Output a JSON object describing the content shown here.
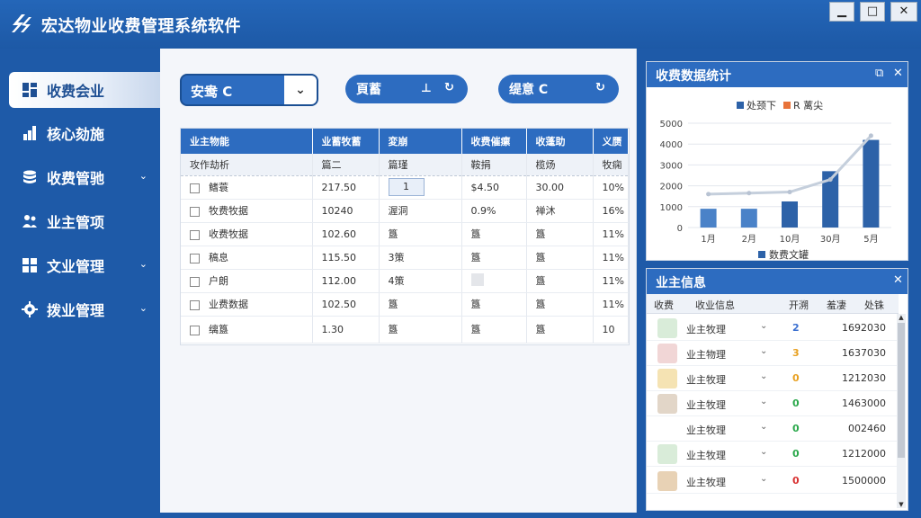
{
  "app": {
    "title": "宏达物业收费管理系统软件",
    "window_buttons": [
      "▁",
      "□",
      "✕"
    ]
  },
  "sidebar": {
    "items": [
      {
        "label": "收费会业",
        "icon": "grid-icon",
        "active": true,
        "has_chevron": false
      },
      {
        "label": "核心劾施",
        "icon": "bar-chart-icon",
        "active": false,
        "has_chevron": false
      },
      {
        "label": "收费管驰",
        "icon": "database-icon",
        "active": false,
        "has_chevron": true
      },
      {
        "label": "业主管项",
        "icon": "people-icon",
        "active": false,
        "has_chevron": false
      },
      {
        "label": "文业管理",
        "icon": "grid-icon",
        "active": false,
        "has_chevron": true
      },
      {
        "label": "拨业管理",
        "icon": "gear-icon",
        "active": false,
        "has_chevron": true
      }
    ]
  },
  "toolbar": {
    "select_value": "安鸯 C",
    "btn_search": "頁蓄",
    "btn_filter": "缇意 C"
  },
  "table": {
    "headers": [
      "业主物能",
      "业蓄牧蓄",
      "変崩",
      "收费催瘰",
      "收蓬助",
      "义赝"
    ],
    "subheader": [
      "攻作劫析",
      "篇二",
      "篇瑾",
      "鞍捐",
      "榄炀",
      "牧痫"
    ],
    "rows": [
      [
        "鳍蓑",
        "217.50",
        "1",
        "$4.50",
        "30.00",
        "10%"
      ],
      [
        "牧费牧据",
        "10240",
        "渥洞",
        "0.9%",
        "禅沐",
        "16%"
      ],
      [
        "收费牧据",
        "102.60",
        "簋",
        "簋",
        "簋",
        "11%"
      ],
      [
        "稿息",
        "115.50",
        "3策",
        "簋",
        "簋",
        "11%"
      ],
      [
        "户朗",
        "112.00",
        "4策",
        "",
        "簋",
        "11%"
      ],
      [
        "业费数据",
        "102.50",
        "簋",
        "簋",
        "簋",
        "11%"
      ],
      [
        "缡簋",
        "1.30",
        "簋",
        "簋",
        "簋",
        "10"
      ]
    ]
  },
  "stats_panel": {
    "title": "收费数据统计",
    "legend_bar": "处颈下",
    "legend_line": "R 蓠尖",
    "legend_bottom": "数费文罐"
  },
  "chart_data": {
    "type": "bar",
    "categories": [
      "1月",
      "2月",
      "10月",
      "30月",
      "5月"
    ],
    "series": [
      {
        "name": "处颈下",
        "type": "bar",
        "values": [
          900,
          900,
          1250,
          2700,
          4200
        ]
      },
      {
        "name": "R 蓠尖",
        "type": "line",
        "values": [
          1600,
          1650,
          1700,
          2300,
          4400
        ]
      }
    ],
    "yticks": [
      0,
      1000,
      2000,
      3000,
      4000,
      5000
    ],
    "ylim": [
      0,
      5000
    ],
    "colors": {
      "bar": "#2d62a8",
      "bar_light": "#4a82c8",
      "line": "#c5cfdc"
    },
    "grid": true
  },
  "owner_panel": {
    "title": "业主信息",
    "columns": [
      "收费",
      "收业信息",
      "开溯",
      "羞凄",
      "处铢"
    ],
    "rows": [
      {
        "avatar": "house-avatar",
        "name": "业主牧理",
        "count": "2",
        "count_color": "#3a6fd0",
        "value": "1692030"
      },
      {
        "avatar": "people-avatar",
        "name": "业主物理",
        "count": "3",
        "count_color": "#e8a020",
        "value": "1637030"
      },
      {
        "avatar": "folder-avatar",
        "name": "业主牧理",
        "count": "0",
        "count_color": "#e8a020",
        "value": "1212030"
      },
      {
        "avatar": "person-avatar",
        "name": "业主牧理",
        "count": "0",
        "count_color": "#2aa84a",
        "value": "1463000"
      },
      {
        "avatar": "",
        "name": "业主牧理",
        "count": "0",
        "count_color": "#2aa84a",
        "value": "002460"
      },
      {
        "avatar": "house-avatar",
        "name": "业主牧理",
        "count": "0",
        "count_color": "#2aa84a",
        "value": "1212000"
      },
      {
        "avatar": "box-avatar",
        "name": "业主牧理",
        "count": "0",
        "count_color": "#d83030",
        "value": "1500000"
      }
    ]
  }
}
